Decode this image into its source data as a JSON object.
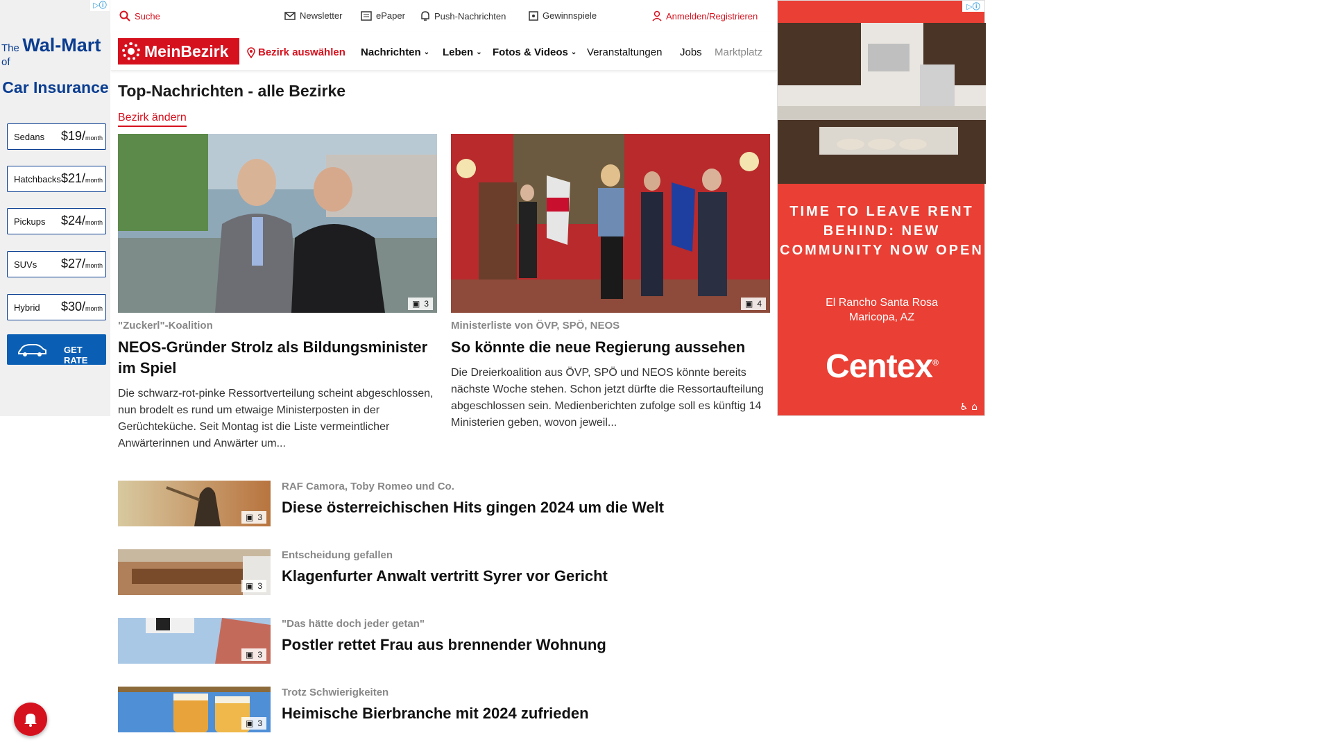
{
  "left_ad": {
    "adchoice": "▷ⓘ",
    "brand_the": "The",
    "brand_name": "Wal-Mart",
    "brand_of": "of",
    "brand_sub": "Car Insurance",
    "rows": [
      {
        "label": "Sedans",
        "price": "$19/",
        "unit": "month"
      },
      {
        "label": "Hatchbacks",
        "price": "$21/",
        "unit": "month"
      },
      {
        "label": "Pickups",
        "price": "$24/",
        "unit": "month"
      },
      {
        "label": "SUVs",
        "price": "$27/",
        "unit": "month"
      },
      {
        "label": "Hybrid",
        "price": "$30/",
        "unit": "month"
      }
    ],
    "cta": "GET RATE"
  },
  "utility": {
    "search": "Suche",
    "newsletter": "Newsletter",
    "epaper": "ePaper",
    "push": "Push-Nachrichten",
    "gewinnspiele": "Gewinnspiele",
    "login": "Anmelden/Registrieren"
  },
  "nav": {
    "logo": "MeinBezirk",
    "bezirk": "Bezirk auswählen",
    "items": [
      "Nachrichten",
      "Leben",
      "Fotos & Videos",
      "Veranstaltungen",
      "Jobs",
      "Marktplatz"
    ]
  },
  "page": {
    "heading": "Top-Nachrichten - alle Bezirke",
    "change": "Bezirk ändern"
  },
  "featured": [
    {
      "count": "3",
      "kicker": "\"Zuckerl\"-Koalition",
      "title": "NEOS-Gründer Strolz als Bildungsminister im Spiel",
      "teaser": "Die schwarz-rot-pinke Ressortverteilung scheint abgeschlossen, nun brodelt es rund um etwaige Ministerposten in der Gerüchteküche. Seit Montag ist die Liste vermeintlicher Anwärterinnen und Anwärter um..."
    },
    {
      "count": "4",
      "kicker": "Ministerliste von ÖVP, SPÖ, NEOS",
      "title": "So könnte die neue Regierung aussehen",
      "teaser": "Die Dreierkoalition aus ÖVP, SPÖ und NEOS könnte bereits nächste Woche stehen. Schon jetzt dürfte die Ressortaufteilung abgeschlossen sein. Medienberichten zufolge soll es künftig 14 Ministerien geben, wovon jeweil..."
    }
  ],
  "list": [
    {
      "count": "3",
      "kicker": "RAF Camora, Toby Romeo und Co.",
      "title": "Diese österreichischen Hits gingen 2024 um die Welt"
    },
    {
      "count": "3",
      "kicker": "Entscheidung gefallen",
      "title": "Klagenfurter Anwalt vertritt Syrer vor Gericht"
    },
    {
      "count": "3",
      "kicker": "\"Das hätte doch jeder getan\"",
      "title": "Postler rettet Frau aus brennender Wohnung"
    },
    {
      "count": "3",
      "kicker": "Trotz Schwierigkeiten",
      "title": "Heimische Bierbranche mit 2024 zufrieden"
    }
  ],
  "right_ad": {
    "adchoice": "▷ⓘ",
    "headline": "TIME TO LEAVE RENT BEHIND: NEW COMMUNITY NOW OPEN",
    "location_1": "El Rancho Santa Rosa",
    "location_2": "Maricopa, AZ",
    "brand": "Centex",
    "brand_mark": "®"
  },
  "colors": {
    "accent": "#d6111e",
    "ad_red": "#ea3f34",
    "ad_blue": "#0a3d91"
  }
}
